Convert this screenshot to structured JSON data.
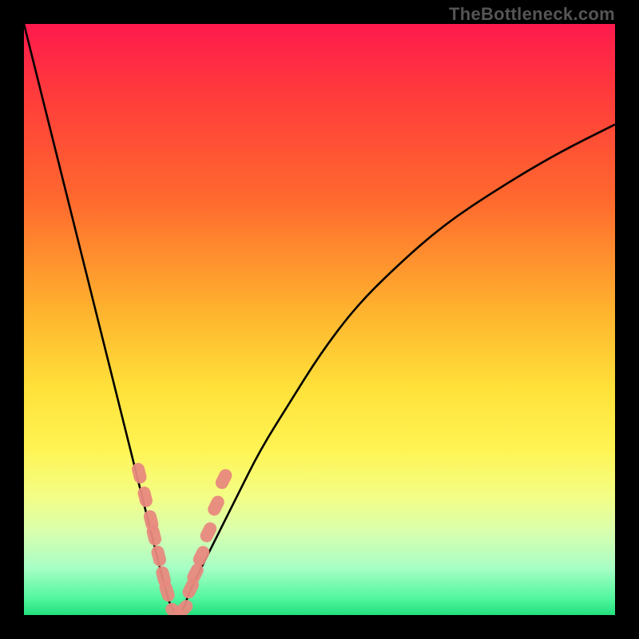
{
  "watermark": {
    "text": "TheBottleneck.com"
  },
  "colors": {
    "frame": "#000000",
    "curve_stroke": "#000000",
    "marker_fill": "#e8897e",
    "marker_stroke": "#e8897e",
    "gradient_stops": [
      "#ff1a4d",
      "#ff3b3b",
      "#ff6a2e",
      "#ffb12e",
      "#ffe23a",
      "#fff454",
      "#f3fe86",
      "#d8ffae",
      "#a8fec6",
      "#55f7a0",
      "#23e07e"
    ]
  },
  "chart_data": {
    "type": "line",
    "title": "",
    "xlabel": "",
    "ylabel": "",
    "xlim": [
      0,
      100
    ],
    "ylim": [
      0,
      100
    ],
    "grid": false,
    "legend": false,
    "series": [
      {
        "name": "bottleneck-curve",
        "x": [
          0,
          2,
          4,
          6,
          8,
          10,
          12,
          14,
          16,
          18,
          20,
          21,
          22,
          23,
          24,
          25,
          26,
          27,
          28,
          30,
          33,
          36,
          40,
          45,
          50,
          56,
          63,
          71,
          80,
          90,
          100
        ],
        "y": [
          100,
          92,
          84,
          76,
          68,
          60,
          52,
          44,
          36,
          28,
          20,
          16,
          12,
          8,
          4,
          1,
          0,
          1,
          4,
          8,
          14,
          20,
          28,
          36,
          44,
          52,
          59,
          66,
          72,
          78,
          83
        ]
      }
    ],
    "markers": {
      "name": "highlighted-points",
      "x": [
        19.5,
        20.5,
        21.5,
        22.0,
        22.8,
        23.6,
        24.2,
        25.5,
        27.0,
        28.2,
        29.0,
        30.0,
        31.2,
        32.5,
        33.8
      ],
      "y": [
        24.0,
        20.0,
        16.0,
        13.5,
        10.0,
        6.5,
        4.0,
        0.5,
        1.0,
        4.5,
        7.0,
        10.0,
        14.0,
        18.5,
        23.0
      ]
    }
  }
}
